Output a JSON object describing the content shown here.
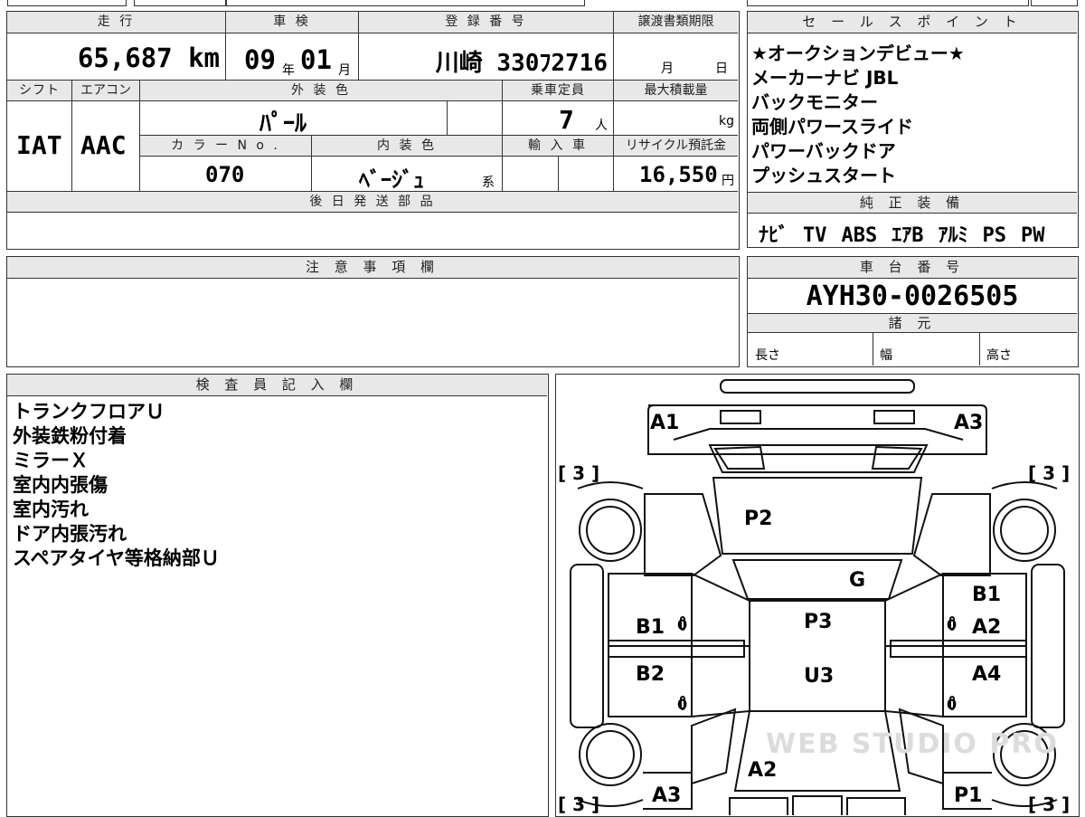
{
  "top_strip": {
    "partial_text": "■■■■"
  },
  "mileage": {
    "label": "走 行",
    "value": "65,687 km"
  },
  "inspection": {
    "label": "車 検",
    "year": "09",
    "year_unit": "年",
    "month": "01",
    "month_unit": "月"
  },
  "registration": {
    "label": "登 録 番 号",
    "value": "川崎 330ﾌ2716"
  },
  "transfer_deadline": {
    "label": "譲渡書類期限",
    "month_unit": "月",
    "day_unit": "日"
  },
  "shift": {
    "label": "シフト",
    "value": "IAT"
  },
  "aircon": {
    "label": "エアコン",
    "value": "AAC"
  },
  "exterior_color": {
    "label": "外 装 色",
    "value": "ﾊﾟｰﾙ"
  },
  "capacity": {
    "label": "乗車定員",
    "value": "7",
    "unit": "人"
  },
  "max_load": {
    "label": "最大積載量",
    "unit": "kg"
  },
  "color_no": {
    "label": "カ ラ ー N o .",
    "value": "070"
  },
  "interior_color": {
    "label": "内 装 色",
    "value": "ﾍﾞｰｼﾞｭ",
    "suffix": "系"
  },
  "import_car": {
    "label": "輸 入 車"
  },
  "recycle": {
    "label": "リサイクル預託金",
    "value": "16,550",
    "unit": "円"
  },
  "later_parts": {
    "label": "後 日 発 送 部 品"
  },
  "sales_points": {
    "label": "セ ー ル ス ポ イ ン ト",
    "items": [
      "★オークションデビュー★",
      "メーカーナビ JBL",
      "バックモニター",
      "両側パワースライド",
      "パワーバックドア",
      "プッシュスタート"
    ]
  },
  "genuine_equipment": {
    "label": "純 正 装 備",
    "items": [
      "ﾅﾋﾞ",
      "TV",
      "ABS",
      "ｴｱB",
      "ｱﾙﾐ",
      "PS",
      "PW"
    ]
  },
  "notes": {
    "label": "注 意 事 項 欄"
  },
  "chassis": {
    "label": "車 台 番 号",
    "value": "AYH30-0026505"
  },
  "specs": {
    "label": "諸 元",
    "length": "長さ",
    "width": "幅",
    "height": "高さ"
  },
  "inspector": {
    "label": "検 査 員 記 入 欄",
    "lines": [
      "トランクフロアＵ",
      "外装鉄粉付着",
      "ミラーＸ",
      "室内内張傷",
      "室内汚れ",
      "ドア内張汚れ",
      "スペアタイヤ等格納部Ｕ"
    ]
  },
  "diagram": {
    "codes": {
      "a1_top": "A1",
      "a3_top": "A3",
      "p2": "P2",
      "g": "G",
      "b1_right": "B1",
      "b1_left": "B1",
      "p3": "P3",
      "a2_right": "A2",
      "b2": "B2",
      "u3": "U3",
      "a4": "A4",
      "a2_bottom": "A2",
      "a3_bottom": "A3",
      "p1": "P1"
    },
    "tread": {
      "fl": "[ 3 ]",
      "fr": "[ 3 ]",
      "rl": "[ 3 ]",
      "rr": "[ 3 ]"
    },
    "zeros": {
      "l1": "0",
      "l2": "0",
      "r1": "0",
      "r2": "0"
    },
    "watermark": "WEB STUDIO PRO"
  }
}
